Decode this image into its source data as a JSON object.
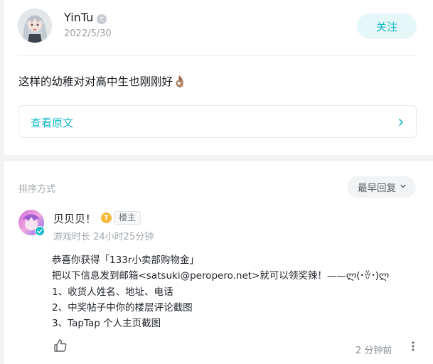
{
  "post": {
    "author": "YinTu",
    "date": "2022/5/30",
    "follow_label": "关注",
    "text": "这样的幼稚对对高中生也刚刚好👌🏽",
    "view_original": "查看原文"
  },
  "comments_header": {
    "sort_label": "排序方式",
    "sort_value": "最早回复"
  },
  "comment": {
    "author": "贝贝贝！",
    "level_badge": "T",
    "op_tag": "楼主",
    "meta": "游戏时长 24小时25分钟",
    "lines": [
      "恭喜你获得「133r小卖部购物金」",
      "把以下信息发到邮箱<satsuki@peropero.net>就可以领奖辣！——ლ(･ꈊ･)ლ",
      "1、收货人姓名、地址、电话",
      "2、中奖帖子中你的楼层评论截图",
      "3、TapTap 个人主页截图"
    ],
    "time": "2 分钟前"
  },
  "colors": {
    "accent": "#14b9c8",
    "follow_bg": "#e6f7f8",
    "page_bg": "#f2f3f5"
  },
  "icons": [
    "verified-badge-icon",
    "chevron-right-icon",
    "chevron-down-icon",
    "verified-check-icon",
    "thumbs-up-icon",
    "more-vertical-icon"
  ]
}
